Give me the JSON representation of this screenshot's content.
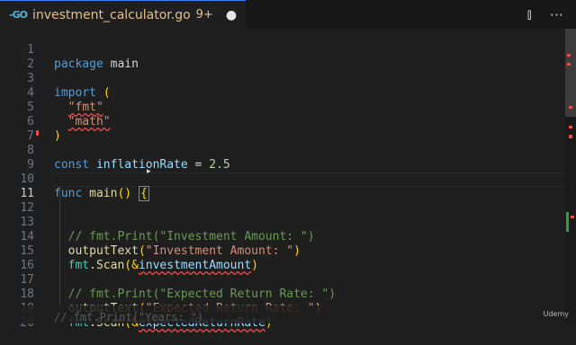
{
  "tab": {
    "icon": "go-file-icon",
    "icon_text": "-GO",
    "filename": "investment_calculator.go",
    "problems": "9+",
    "dirty": "●"
  },
  "actions": {
    "split": "⫾",
    "more": "···"
  },
  "lines": [
    {
      "n": "1"
    },
    {
      "n": "2"
    },
    {
      "n": "3"
    },
    {
      "n": "4"
    },
    {
      "n": "5"
    },
    {
      "n": "6"
    },
    {
      "n": "7"
    },
    {
      "n": "8"
    },
    {
      "n": "9"
    },
    {
      "n": "10"
    },
    {
      "n": "11"
    },
    {
      "n": "12"
    },
    {
      "n": "13"
    },
    {
      "n": "14"
    },
    {
      "n": "15"
    },
    {
      "n": "16"
    },
    {
      "n": "17"
    },
    {
      "n": "18"
    },
    {
      "n": "19"
    },
    {
      "n": "20"
    }
  ],
  "code": {
    "l1_kw": "package",
    "l1_id": "main",
    "l3_kw": "import",
    "l3_p": "(",
    "l4": "\"fmt\"",
    "l5": "\"math\"",
    "l6": ")",
    "l8_kw": "const",
    "l8_id": "inflationRate",
    "l8_op": "=",
    "l8_num": "2.5",
    "l10_kw": "func",
    "l10_fn": "main",
    "l10_p": "()",
    "l10_b": "{",
    "l13": "// fmt.Print(\"Investment Amount: \")",
    "l14_fn": "outputText",
    "l14_o": "(",
    "l14_s": "\"Investment Amount: \"",
    "l14_c": ")",
    "l15_pk": "fmt",
    "l15_dot": ".",
    "l15_fn": "Scan",
    "l15_o": "(&",
    "l15_id": "investmentAmount",
    "l15_c": ")",
    "l17": "// fmt.Print(\"Expected Return Rate: \")",
    "l18_fn": "outputText",
    "l18_o": "(",
    "l18_s": "\"Expected Return Rate: \"",
    "l18_c": ")",
    "l19_pk": "fmt",
    "l19_dot": ".",
    "l19_fn": "Scan",
    "l19_o": "(&",
    "l19_id": "expectedReturnRate",
    "l19_c": ")",
    "l21": "// fmt.Print(\"Years: \")"
  },
  "watermark": "Udemy",
  "colors": {
    "accent": "#3b82f6",
    "error": "#f14c4c",
    "added": "#2ea043"
  }
}
